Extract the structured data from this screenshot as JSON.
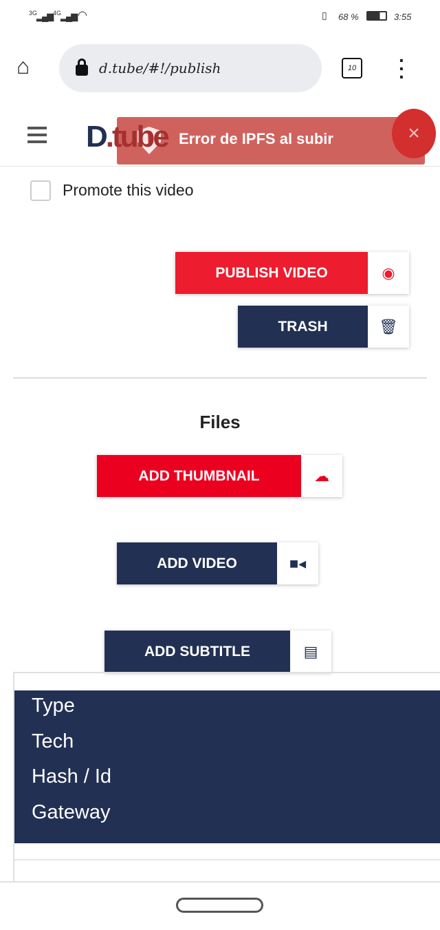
{
  "status_bar": {
    "signal_1": "3G",
    "signal_2": "4G",
    "battery": "68 %",
    "time": "3:55"
  },
  "browser": {
    "url": "d.tube/#!/publish",
    "tab_count": "10"
  },
  "header": {
    "logo_a": "D",
    "logo_b": ".tube"
  },
  "toast": {
    "message": "Error de IPFS al subir",
    "close": "×"
  },
  "promote": {
    "label": "Promote this video",
    "checked": false
  },
  "actions": {
    "publish": "PUBLISH VIDEO",
    "trash": "TRASH"
  },
  "files": {
    "title": "Files",
    "add_thumbnail": "ADD THUMBNAIL",
    "add_video": "ADD VIDEO",
    "add_subtitle": "ADD SUBTITLE"
  },
  "table": {
    "headers": [
      "Type",
      "Tech",
      "Hash / Id",
      "Gateway"
    ]
  },
  "colors": {
    "red": "#ed1c2e",
    "navy": "#223053",
    "toast": "#c84642"
  }
}
